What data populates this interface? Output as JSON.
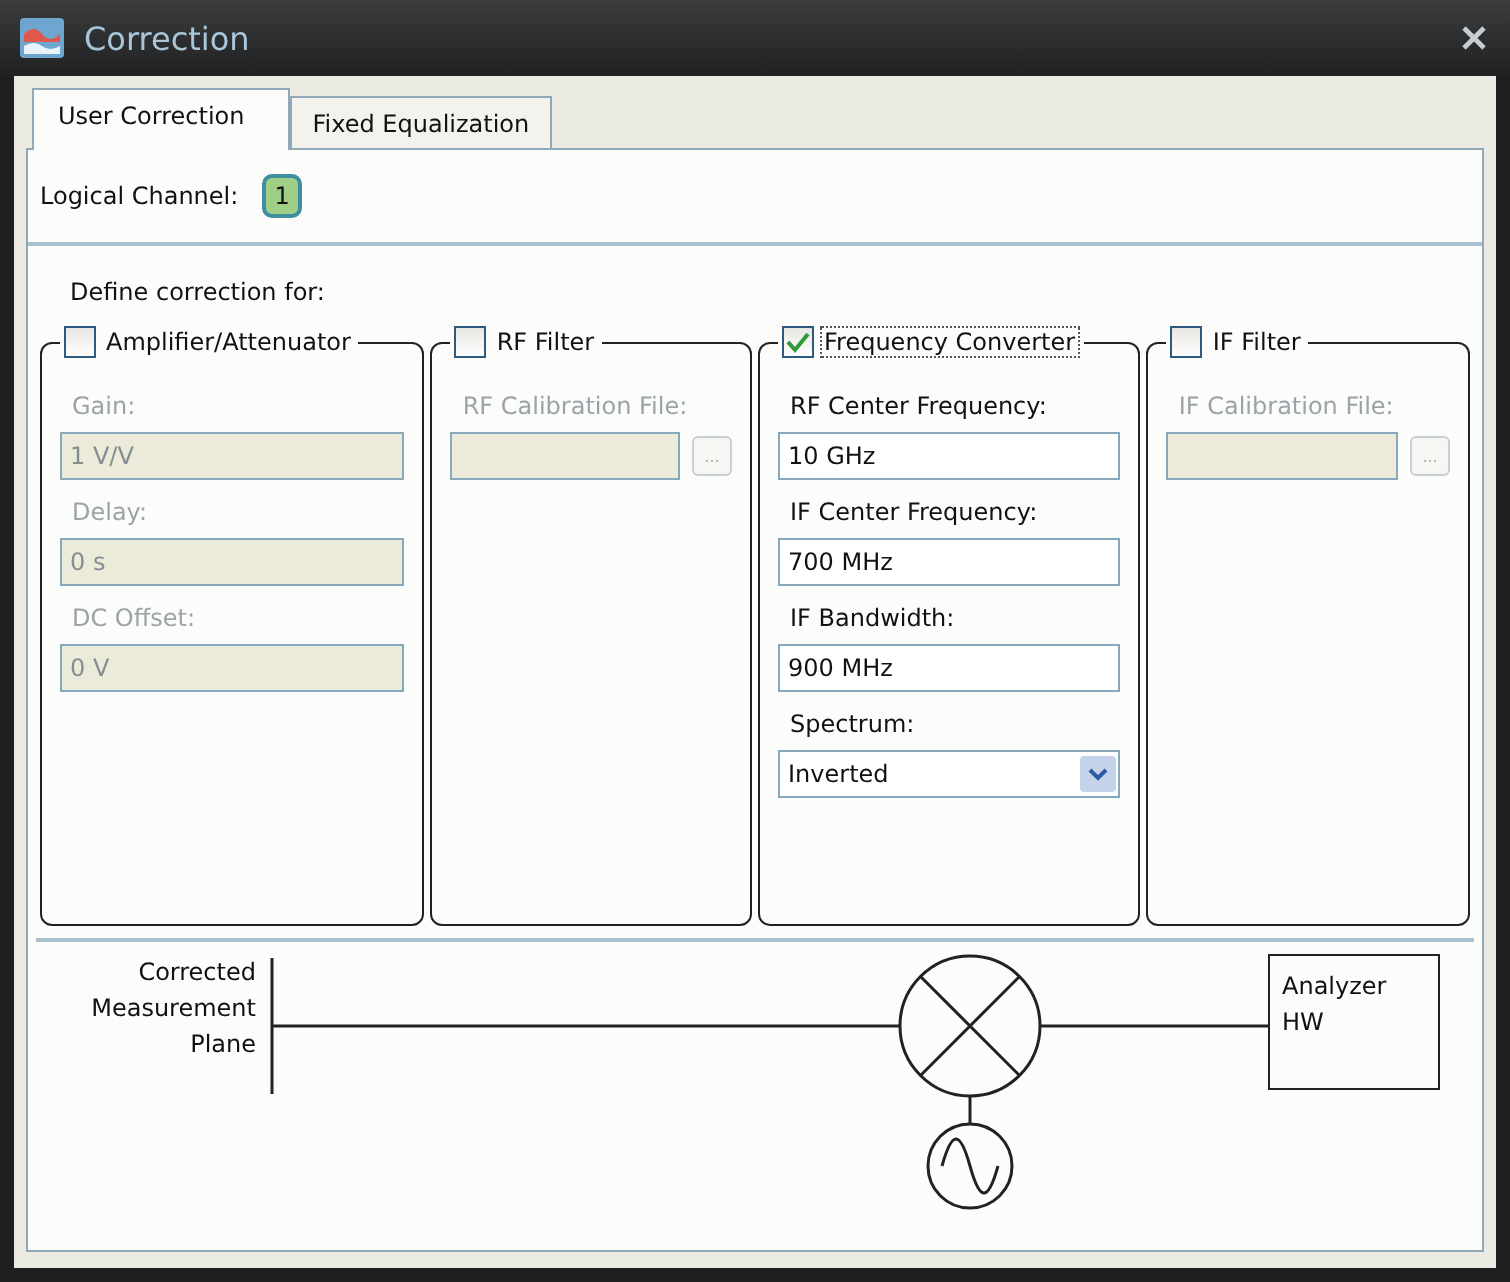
{
  "window": {
    "title": "Correction"
  },
  "tabs": [
    {
      "label": "User Correction",
      "selected": true
    },
    {
      "label": "Fixed Equalization",
      "selected": false
    }
  ],
  "logical_channel": {
    "label": "Logical Channel:",
    "value": "1"
  },
  "section_label": "Define correction for:",
  "groups": [
    {
      "label": "Amplifier/Attenuator",
      "checked": false,
      "focused": false,
      "fields": [
        {
          "kind": "text",
          "label": "Gain:",
          "value": "1 V/V"
        },
        {
          "kind": "text",
          "label": "Delay:",
          "value": "0 s"
        },
        {
          "kind": "text",
          "label": "DC Offset:",
          "value": "0 V"
        }
      ]
    },
    {
      "label": "RF Filter",
      "checked": false,
      "focused": false,
      "fields": [
        {
          "kind": "file",
          "label": "RF Calibration File:",
          "button": "..."
        }
      ]
    },
    {
      "label": "Frequency Converter",
      "checked": true,
      "focused": true,
      "fields": [
        {
          "kind": "text",
          "label": "RF Center Frequency:",
          "value": "10 GHz"
        },
        {
          "kind": "text",
          "label": "IF Center Frequency:",
          "value": "700 MHz"
        },
        {
          "kind": "text",
          "label": "IF Bandwidth:",
          "value": "900 MHz"
        },
        {
          "kind": "dropdown",
          "label": "Spectrum:",
          "value": "Inverted"
        }
      ]
    },
    {
      "label": "IF Filter",
      "checked": false,
      "focused": false,
      "fields": [
        {
          "kind": "file",
          "label": "IF Calibration File:",
          "button": "..."
        }
      ]
    }
  ],
  "diagram": {
    "plane_label": "Corrected Measurement Plane",
    "analyzer_label": "Analyzer HW"
  }
}
